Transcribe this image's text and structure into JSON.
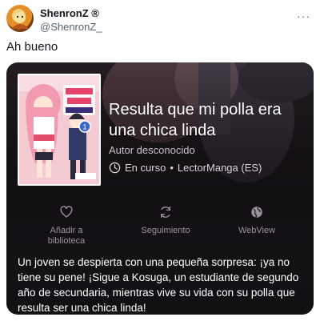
{
  "tweet": {
    "display_name": "ShenronZ ®",
    "handle": "@ShenronZ_",
    "more_glyph": "···",
    "text": "Ah bueno"
  },
  "card": {
    "title": "Resulta que mi polla era una chica linda",
    "author": "Autor desconocido",
    "status": "En curso",
    "separator": "•",
    "source": "LectorManga (ES)",
    "actions": [
      {
        "label": "Añadir a biblioteca",
        "icon": "heart-icon"
      },
      {
        "label": "Seguimiento",
        "icon": "sync-icon"
      },
      {
        "label": "WebView",
        "icon": "globe-icon"
      }
    ],
    "description": "Un joven se despierta con una pequeña sorpresa: ¡ya no tiene su pene! ¡Sigue a Kosuga, un estudiante de segundo año de secundaria, mientras vive su vida con su polla que resulta ser una chica linda!"
  }
}
